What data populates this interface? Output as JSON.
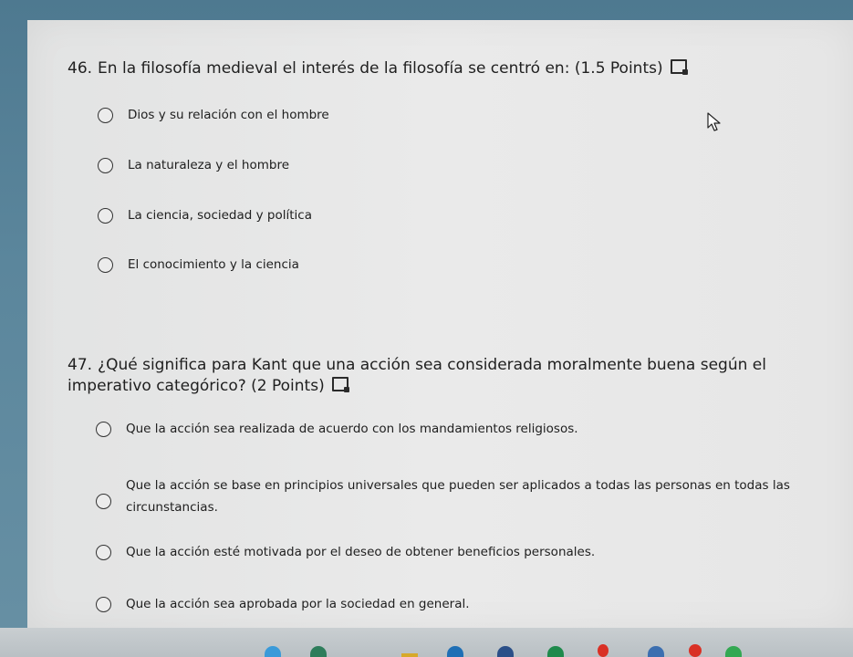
{
  "questions": [
    {
      "number": "46.",
      "text": "En la filosofía medieval el interés de la filosofía se centró en: (1.5 Points)",
      "options": [
        "Dios y su relación con el hombre",
        "La naturaleza y el hombre",
        "La ciencia, sociedad y política",
        "El conocimiento y la ciencia"
      ]
    },
    {
      "number": "47.",
      "text": "¿Qué significa para Kant que una acción sea considerada moralmente buena según el imperativo categórico? (2 Points)",
      "options": [
        "Que la acción sea realizada de acuerdo con los mandamientos religiosos.",
        "Que la acción se base en principios universales que pueden ser aplicados a todas las personas en todas las circunstancias.",
        "Que la acción esté motivada por el deseo de obtener beneficios personales.",
        "Que la acción sea aprobada por la sociedad en general."
      ]
    }
  ],
  "icons": {
    "immersive_reader": "immersive-reader-icon",
    "cursor": "mouse-cursor-icon"
  },
  "colors": {
    "panel_bg": "#e8e8e8",
    "screen_bg": "#5b869c",
    "text": "#1f1f1f"
  }
}
